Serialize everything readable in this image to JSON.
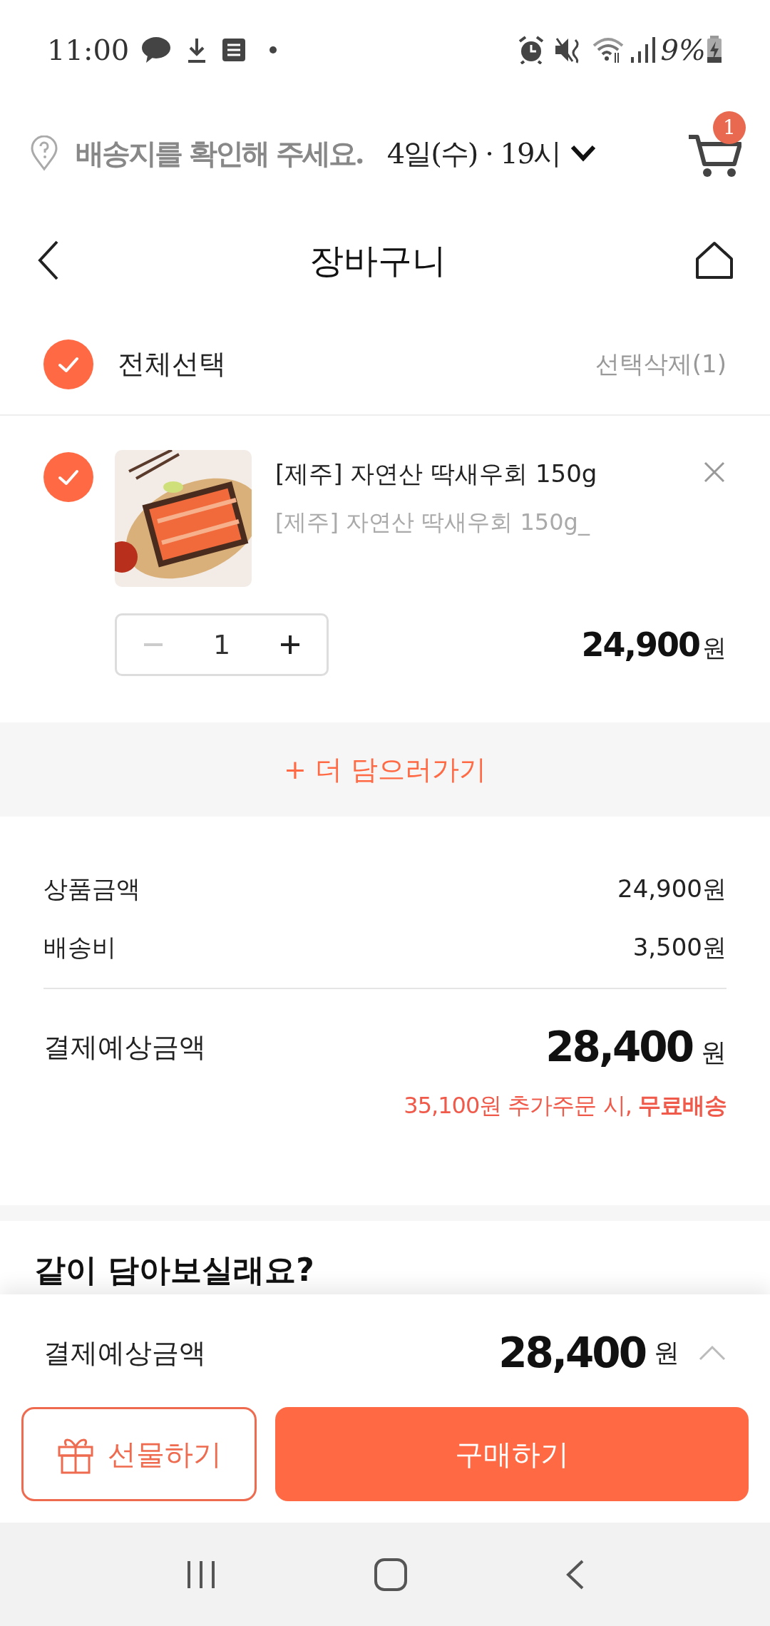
{
  "status_bar": {
    "time": "11:00",
    "battery": "9%"
  },
  "delivery_bar": {
    "address_prompt": "배송지를 확인해 주세요.",
    "delivery_time": "4일(수) · 19시",
    "cart_count": "1"
  },
  "header": {
    "title": "장바구니"
  },
  "select_all": {
    "label": "전체선택",
    "checked": true,
    "delete_selected": "선택삭제(1)"
  },
  "cart_items": [
    {
      "checked": true,
      "name": "[제주] 자연산 딱새우회 150g",
      "option": "[제주] 자연산 딱새우회 150g_",
      "quantity": "1",
      "price": "24,900",
      "currency": "원"
    }
  ],
  "add_more": {
    "icon": "+",
    "label": "더 담으러가기"
  },
  "summary": {
    "rows": [
      {
        "label": "상품금액",
        "value": "24,900원"
      },
      {
        "label": "배송비",
        "value": "3,500원"
      }
    ],
    "total_label": "결제예상금액",
    "total": "28,400",
    "currency": "원",
    "free_shipping_note": "35,100원 추가주문 시, **무료배송**"
  },
  "recommend": {
    "title": "같이 담아보실래요?"
  },
  "bottom_sheet": {
    "total_label": "결제예상금액",
    "total": "28,400",
    "currency": "원",
    "gift_button": "선물하기",
    "buy_button": "구매하기"
  }
}
